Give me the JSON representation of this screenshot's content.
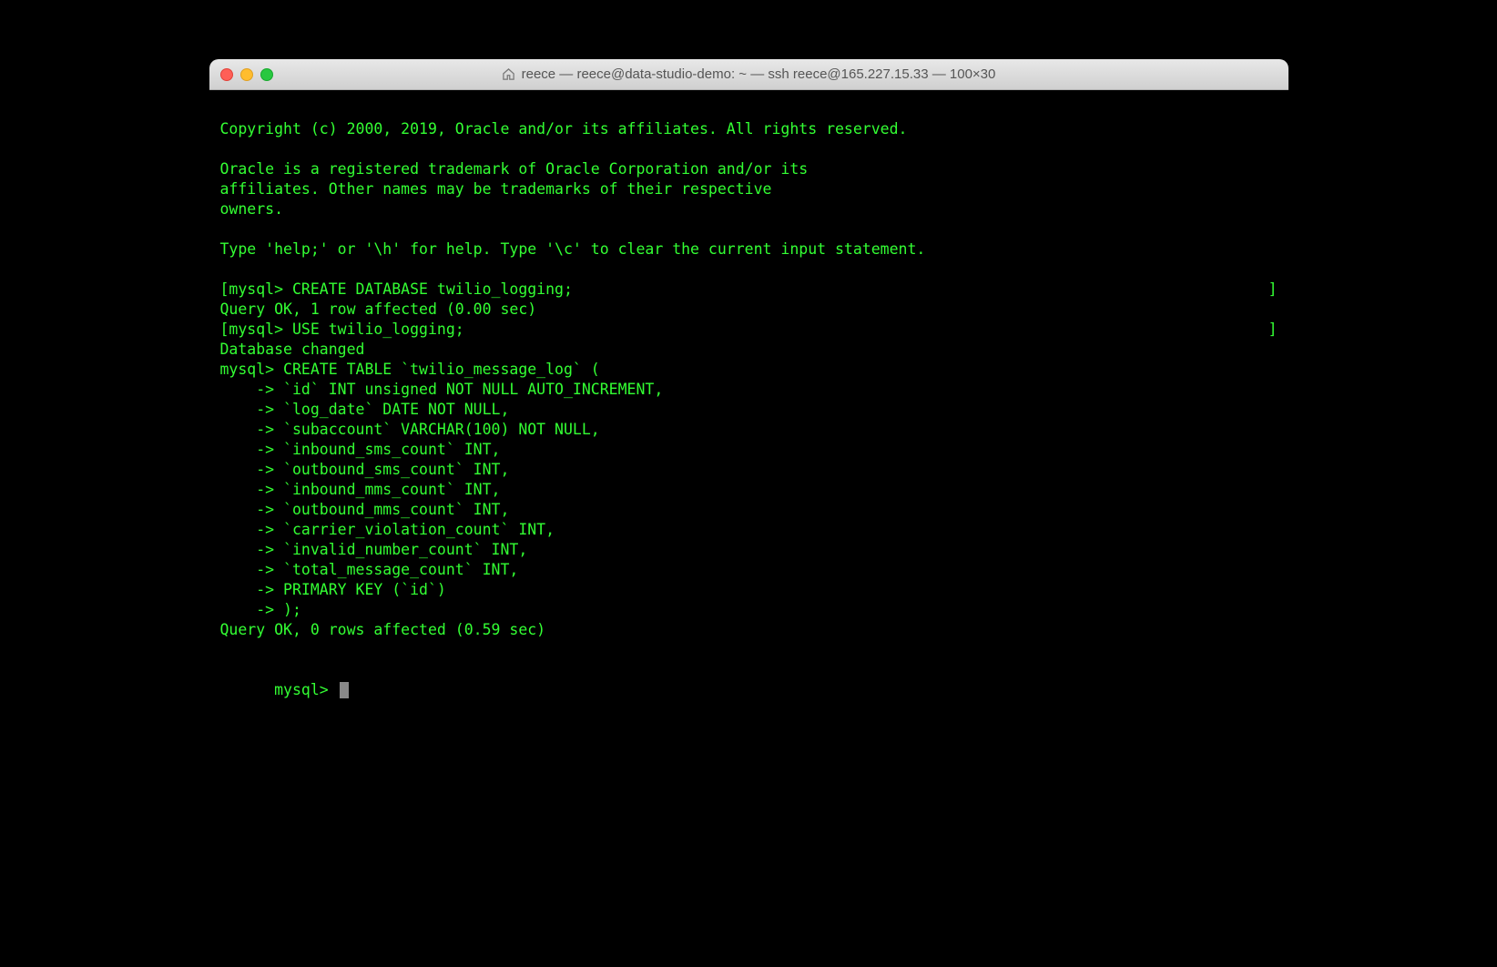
{
  "window": {
    "title": "reece — reece@data-studio-demo: ~ — ssh reece@165.227.15.33 — 100×30",
    "home_icon": "home-icon"
  },
  "terminal": {
    "lines": [
      "",
      "Copyright (c) 2000, 2019, Oracle and/or its affiliates. All rights reserved.",
      "",
      "Oracle is a registered trademark of Oracle Corporation and/or its",
      "affiliates. Other names may be trademarks of their respective",
      "owners.",
      "",
      "Type 'help;' or '\\h' for help. Type '\\c' to clear the current input statement.",
      ""
    ],
    "bracket_line_1_left": "[mysql> CREATE DATABASE twilio_logging;",
    "bracket_line_1_right": "]",
    "after_bracket_1": "Query OK, 1 row affected (0.00 sec)",
    "blank_a": "",
    "bracket_line_2_left": "[mysql> USE twilio_logging;",
    "bracket_line_2_right": "]",
    "lines2": [
      "Database changed",
      "mysql> CREATE TABLE `twilio_message_log` (",
      "    -> `id` INT unsigned NOT NULL AUTO_INCREMENT,",
      "    -> `log_date` DATE NOT NULL,",
      "    -> `subaccount` VARCHAR(100) NOT NULL,",
      "    -> `inbound_sms_count` INT,",
      "    -> `outbound_sms_count` INT,",
      "    -> `inbound_mms_count` INT,",
      "    -> `outbound_mms_count` INT,",
      "    -> `carrier_violation_count` INT,",
      "    -> `invalid_number_count` INT,",
      "    -> `total_message_count` INT,",
      "    -> PRIMARY KEY (`id`)",
      "    -> );",
      "Query OK, 0 rows affected (0.59 sec)",
      ""
    ],
    "prompt": "mysql> "
  }
}
